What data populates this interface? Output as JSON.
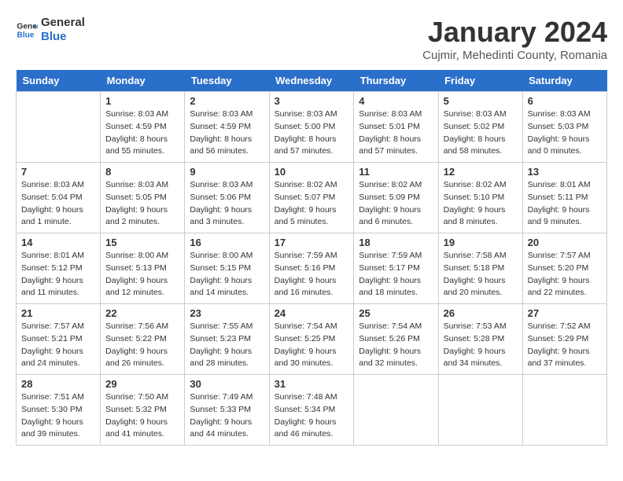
{
  "header": {
    "logo_general": "General",
    "logo_blue": "Blue",
    "month_title": "January 2024",
    "location": "Cujmir, Mehedinti County, Romania"
  },
  "days_of_week": [
    "Sunday",
    "Monday",
    "Tuesday",
    "Wednesday",
    "Thursday",
    "Friday",
    "Saturday"
  ],
  "weeks": [
    [
      {
        "day": "",
        "info": ""
      },
      {
        "day": "1",
        "info": "Sunrise: 8:03 AM\nSunset: 4:59 PM\nDaylight: 8 hours\nand 55 minutes."
      },
      {
        "day": "2",
        "info": "Sunrise: 8:03 AM\nSunset: 4:59 PM\nDaylight: 8 hours\nand 56 minutes."
      },
      {
        "day": "3",
        "info": "Sunrise: 8:03 AM\nSunset: 5:00 PM\nDaylight: 8 hours\nand 57 minutes."
      },
      {
        "day": "4",
        "info": "Sunrise: 8:03 AM\nSunset: 5:01 PM\nDaylight: 8 hours\nand 57 minutes."
      },
      {
        "day": "5",
        "info": "Sunrise: 8:03 AM\nSunset: 5:02 PM\nDaylight: 8 hours\nand 58 minutes."
      },
      {
        "day": "6",
        "info": "Sunrise: 8:03 AM\nSunset: 5:03 PM\nDaylight: 9 hours\nand 0 minutes."
      }
    ],
    [
      {
        "day": "7",
        "info": "Sunrise: 8:03 AM\nSunset: 5:04 PM\nDaylight: 9 hours\nand 1 minute."
      },
      {
        "day": "8",
        "info": "Sunrise: 8:03 AM\nSunset: 5:05 PM\nDaylight: 9 hours\nand 2 minutes."
      },
      {
        "day": "9",
        "info": "Sunrise: 8:03 AM\nSunset: 5:06 PM\nDaylight: 9 hours\nand 3 minutes."
      },
      {
        "day": "10",
        "info": "Sunrise: 8:02 AM\nSunset: 5:07 PM\nDaylight: 9 hours\nand 5 minutes."
      },
      {
        "day": "11",
        "info": "Sunrise: 8:02 AM\nSunset: 5:09 PM\nDaylight: 9 hours\nand 6 minutes."
      },
      {
        "day": "12",
        "info": "Sunrise: 8:02 AM\nSunset: 5:10 PM\nDaylight: 9 hours\nand 8 minutes."
      },
      {
        "day": "13",
        "info": "Sunrise: 8:01 AM\nSunset: 5:11 PM\nDaylight: 9 hours\nand 9 minutes."
      }
    ],
    [
      {
        "day": "14",
        "info": "Sunrise: 8:01 AM\nSunset: 5:12 PM\nDaylight: 9 hours\nand 11 minutes."
      },
      {
        "day": "15",
        "info": "Sunrise: 8:00 AM\nSunset: 5:13 PM\nDaylight: 9 hours\nand 12 minutes."
      },
      {
        "day": "16",
        "info": "Sunrise: 8:00 AM\nSunset: 5:15 PM\nDaylight: 9 hours\nand 14 minutes."
      },
      {
        "day": "17",
        "info": "Sunrise: 7:59 AM\nSunset: 5:16 PM\nDaylight: 9 hours\nand 16 minutes."
      },
      {
        "day": "18",
        "info": "Sunrise: 7:59 AM\nSunset: 5:17 PM\nDaylight: 9 hours\nand 18 minutes."
      },
      {
        "day": "19",
        "info": "Sunrise: 7:58 AM\nSunset: 5:18 PM\nDaylight: 9 hours\nand 20 minutes."
      },
      {
        "day": "20",
        "info": "Sunrise: 7:57 AM\nSunset: 5:20 PM\nDaylight: 9 hours\nand 22 minutes."
      }
    ],
    [
      {
        "day": "21",
        "info": "Sunrise: 7:57 AM\nSunset: 5:21 PM\nDaylight: 9 hours\nand 24 minutes."
      },
      {
        "day": "22",
        "info": "Sunrise: 7:56 AM\nSunset: 5:22 PM\nDaylight: 9 hours\nand 26 minutes."
      },
      {
        "day": "23",
        "info": "Sunrise: 7:55 AM\nSunset: 5:23 PM\nDaylight: 9 hours\nand 28 minutes."
      },
      {
        "day": "24",
        "info": "Sunrise: 7:54 AM\nSunset: 5:25 PM\nDaylight: 9 hours\nand 30 minutes."
      },
      {
        "day": "25",
        "info": "Sunrise: 7:54 AM\nSunset: 5:26 PM\nDaylight: 9 hours\nand 32 minutes."
      },
      {
        "day": "26",
        "info": "Sunrise: 7:53 AM\nSunset: 5:28 PM\nDaylight: 9 hours\nand 34 minutes."
      },
      {
        "day": "27",
        "info": "Sunrise: 7:52 AM\nSunset: 5:29 PM\nDaylight: 9 hours\nand 37 minutes."
      }
    ],
    [
      {
        "day": "28",
        "info": "Sunrise: 7:51 AM\nSunset: 5:30 PM\nDaylight: 9 hours\nand 39 minutes."
      },
      {
        "day": "29",
        "info": "Sunrise: 7:50 AM\nSunset: 5:32 PM\nDaylight: 9 hours\nand 41 minutes."
      },
      {
        "day": "30",
        "info": "Sunrise: 7:49 AM\nSunset: 5:33 PM\nDaylight: 9 hours\nand 44 minutes."
      },
      {
        "day": "31",
        "info": "Sunrise: 7:48 AM\nSunset: 5:34 PM\nDaylight: 9 hours\nand 46 minutes."
      },
      {
        "day": "",
        "info": ""
      },
      {
        "day": "",
        "info": ""
      },
      {
        "day": "",
        "info": ""
      }
    ]
  ]
}
